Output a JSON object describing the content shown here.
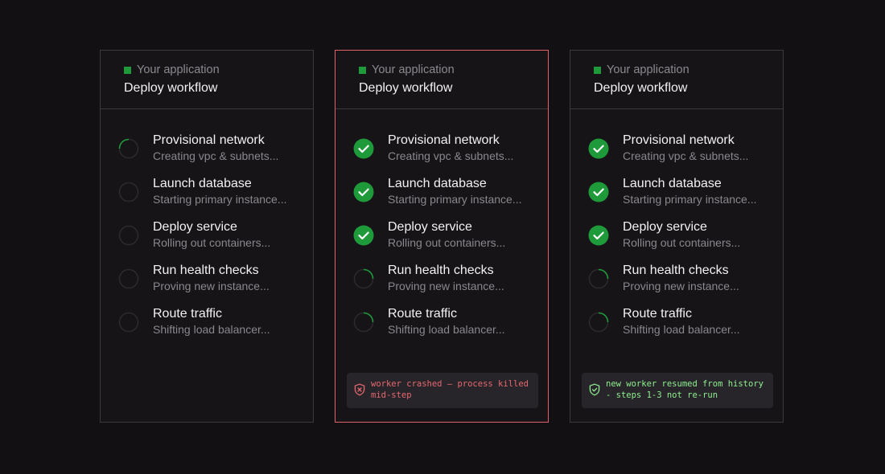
{
  "cards": [
    {
      "app_label": "Your application",
      "title": "Deploy workflow",
      "steps": [
        {
          "title": "Provisional network",
          "sub": "Creating vpc & subnets...",
          "status": "running"
        },
        {
          "title": "Launch database",
          "sub": "Starting primary instance...",
          "status": "pending"
        },
        {
          "title": "Deploy service",
          "sub": "Rolling out containers...",
          "status": "pending"
        },
        {
          "title": "Run health checks",
          "sub": "Proving new instance...",
          "status": "pending"
        },
        {
          "title": "Route traffic",
          "sub": "Shifting load balancer...",
          "status": "pending"
        }
      ]
    },
    {
      "app_label": "Your application",
      "title": "Deploy workflow",
      "steps": [
        {
          "title": "Provisional network",
          "sub": "Creating vpc & subnets...",
          "status": "done"
        },
        {
          "title": "Launch database",
          "sub": "Starting primary instance...",
          "status": "done"
        },
        {
          "title": "Deploy service",
          "sub": "Rolling out containers...",
          "status": "done"
        },
        {
          "title": "Run health checks",
          "sub": "Proving new instance...",
          "status": "running"
        },
        {
          "title": "Route traffic",
          "sub": "Shifting load balancer...",
          "status": "running"
        }
      ],
      "note": {
        "text": "worker crashed — process killed mid-step",
        "kind": "error",
        "icon": "shield-x-icon"
      }
    },
    {
      "app_label": "Your application",
      "title": "Deploy workflow",
      "steps": [
        {
          "title": "Provisional network",
          "sub": "Creating vpc & subnets...",
          "status": "done"
        },
        {
          "title": "Launch database",
          "sub": "Starting primary instance...",
          "status": "done"
        },
        {
          "title": "Deploy service",
          "sub": "Rolling out containers...",
          "status": "done"
        },
        {
          "title": "Run health checks",
          "sub": "Proving new instance...",
          "status": "running"
        },
        {
          "title": "Route traffic",
          "sub": "Shifting load balancer...",
          "status": "running"
        }
      ],
      "note": {
        "text": "new worker resumed from history - steps 1-3 not re-run",
        "kind": "ok",
        "icon": "shield-check-icon"
      }
    }
  ],
  "colors": {
    "background": "#121013",
    "accent_green": "#1f9a3a",
    "error_red": "#e0626a",
    "ok_green": "#8ff08f"
  }
}
